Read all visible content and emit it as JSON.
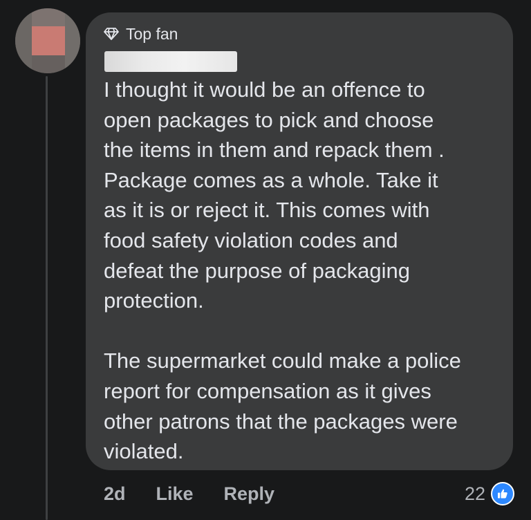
{
  "comment": {
    "badge_label": "Top fan",
    "paragraphs": [
      "I thought it would be an offence to\nopen packages to pick and choose\nthe items in them and repack them .\nPackage comes as a whole. Take it\nas it is or reject it. This comes with\nfood safety violation codes and\ndefeat the purpose of packaging\nprotection.",
      "The supermarket could make a police\nreport for compensation as it gives\nother patrons that the packages were\nviolated."
    ]
  },
  "actions": {
    "time": "2d",
    "like_label": "Like",
    "reply_label": "Reply"
  },
  "reactions": {
    "count": "22",
    "icon": "thumbs-up-icon"
  },
  "colors": {
    "background": "#18191a",
    "bubble": "#3a3b3c",
    "text": "#e4e6eb",
    "muted": "#b0b3b8",
    "like_blue": "#2d88ff"
  }
}
